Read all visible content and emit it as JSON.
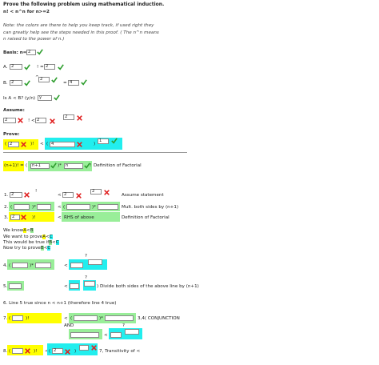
{
  "header": {
    "title": "Prove the following problem using mathematical induction.",
    "statement": "n! < n^n for n>=2",
    "note1": "Note: the colors are there to help you keep track, if used right they",
    "note2": "can greatly help see the steps needed in this proof. ( The n^n means",
    "note3": "n raised to the power of n.)"
  },
  "basis": {
    "label": "Basis: n=",
    "n_value": "2",
    "A_label": "A.",
    "A_v1": "2",
    "A_fact": "! =",
    "A_v2": "2",
    "B_label": "B.",
    "B_v1": "2",
    "B_caret": "^",
    "B_v2": "2",
    "B_eq": "=",
    "B_v3": "4",
    "question": "Is A < B? (y/n)",
    "answer": "y"
  },
  "assume": {
    "label": "Assume:",
    "v1": "2",
    "fact": "! <",
    "v2": "2",
    "v3": "2"
  },
  "prove": {
    "label": "Prove:",
    "open1": "(",
    "v1": "2",
    "close1": ")!",
    "lt": "<",
    "open2": "(",
    "v2": "4",
    "close2": ")",
    "v3": "1"
  },
  "definition": {
    "lhs": "(n+1)! =",
    "open": "(",
    "v1": "n+1",
    "mid": ")*",
    "v2": "n",
    "bang": "!",
    "reason": "Definition of Factorial"
  },
  "steps": {
    "s1_label": "1.",
    "s1_v1": "2",
    "s1_fact": "!",
    "s1_lt": "<",
    "s1_v2": "2",
    "s1_v3": "2",
    "s1_reason": "Assume statement",
    "s2_label": "2.",
    "s2_open1": "(",
    "s2_close1": ")*",
    "s2_lt": "<",
    "s2_open2": "(",
    "s2_close2": ")*",
    "s2_reason": "Mult. both sides by (n+1)",
    "s3_label": "3.",
    "s3_v1": "2",
    "s3_close": ")!",
    "s3_lt": "<",
    "s3_rhs": "RHS of above",
    "s3_reason": "Definition of Factorial"
  },
  "know": {
    "line1_pre": "We know",
    "line1_A": "A",
    "line1_lt": "<",
    "line1_B": "B",
    "line2_pre": "We want to prove",
    "line2_A": "A",
    "line2_lt": "<",
    "line2_C": "C",
    "line3_pre": "This would be true if",
    "line3_B": "B",
    "line3_lt": "<",
    "line3_C": "C",
    "line4_pre": "Now try to prove",
    "line4_B": "B",
    "line4_lt": "<",
    "line4_C": "C"
  },
  "steps2": {
    "s4_label": "4.",
    "s4_open": "(",
    "s4_close": ")*",
    "s4_lt": "<",
    "s4_caret": "?",
    "s5_label": "5.",
    "s5_close": ")",
    "s5_lt": "<",
    "s5_caret": "?",
    "s5_reason": "Divide both sides of the above line by (n+1)",
    "s6": "6. Line 5 true since n < n+1 (therefore line 4 true)",
    "s7_label": "7.",
    "s7_open": "(",
    "s7_close": ")!",
    "s7_lt1": "<",
    "s7_open2": "(",
    "s7_close2": ")*",
    "s7_and": "AND",
    "s7_lt2": "<",
    "s7_caret": "?",
    "s7_reason": "3,4( CONJUNCTION",
    "s8_label": "8.",
    "s8_open": "(",
    "s8_close": ")!",
    "s8_lt": "<",
    "s8_open2": "(",
    "s8_v1": "2",
    "s8_close2": ")",
    "s8_reason": "7, Transitivity of <"
  },
  "colors": {
    "yellow": "#ffff00",
    "green": "#99ee99",
    "cyan": "#22eeee",
    "check": "#2e9e2e",
    "cross": "#e02020"
  }
}
